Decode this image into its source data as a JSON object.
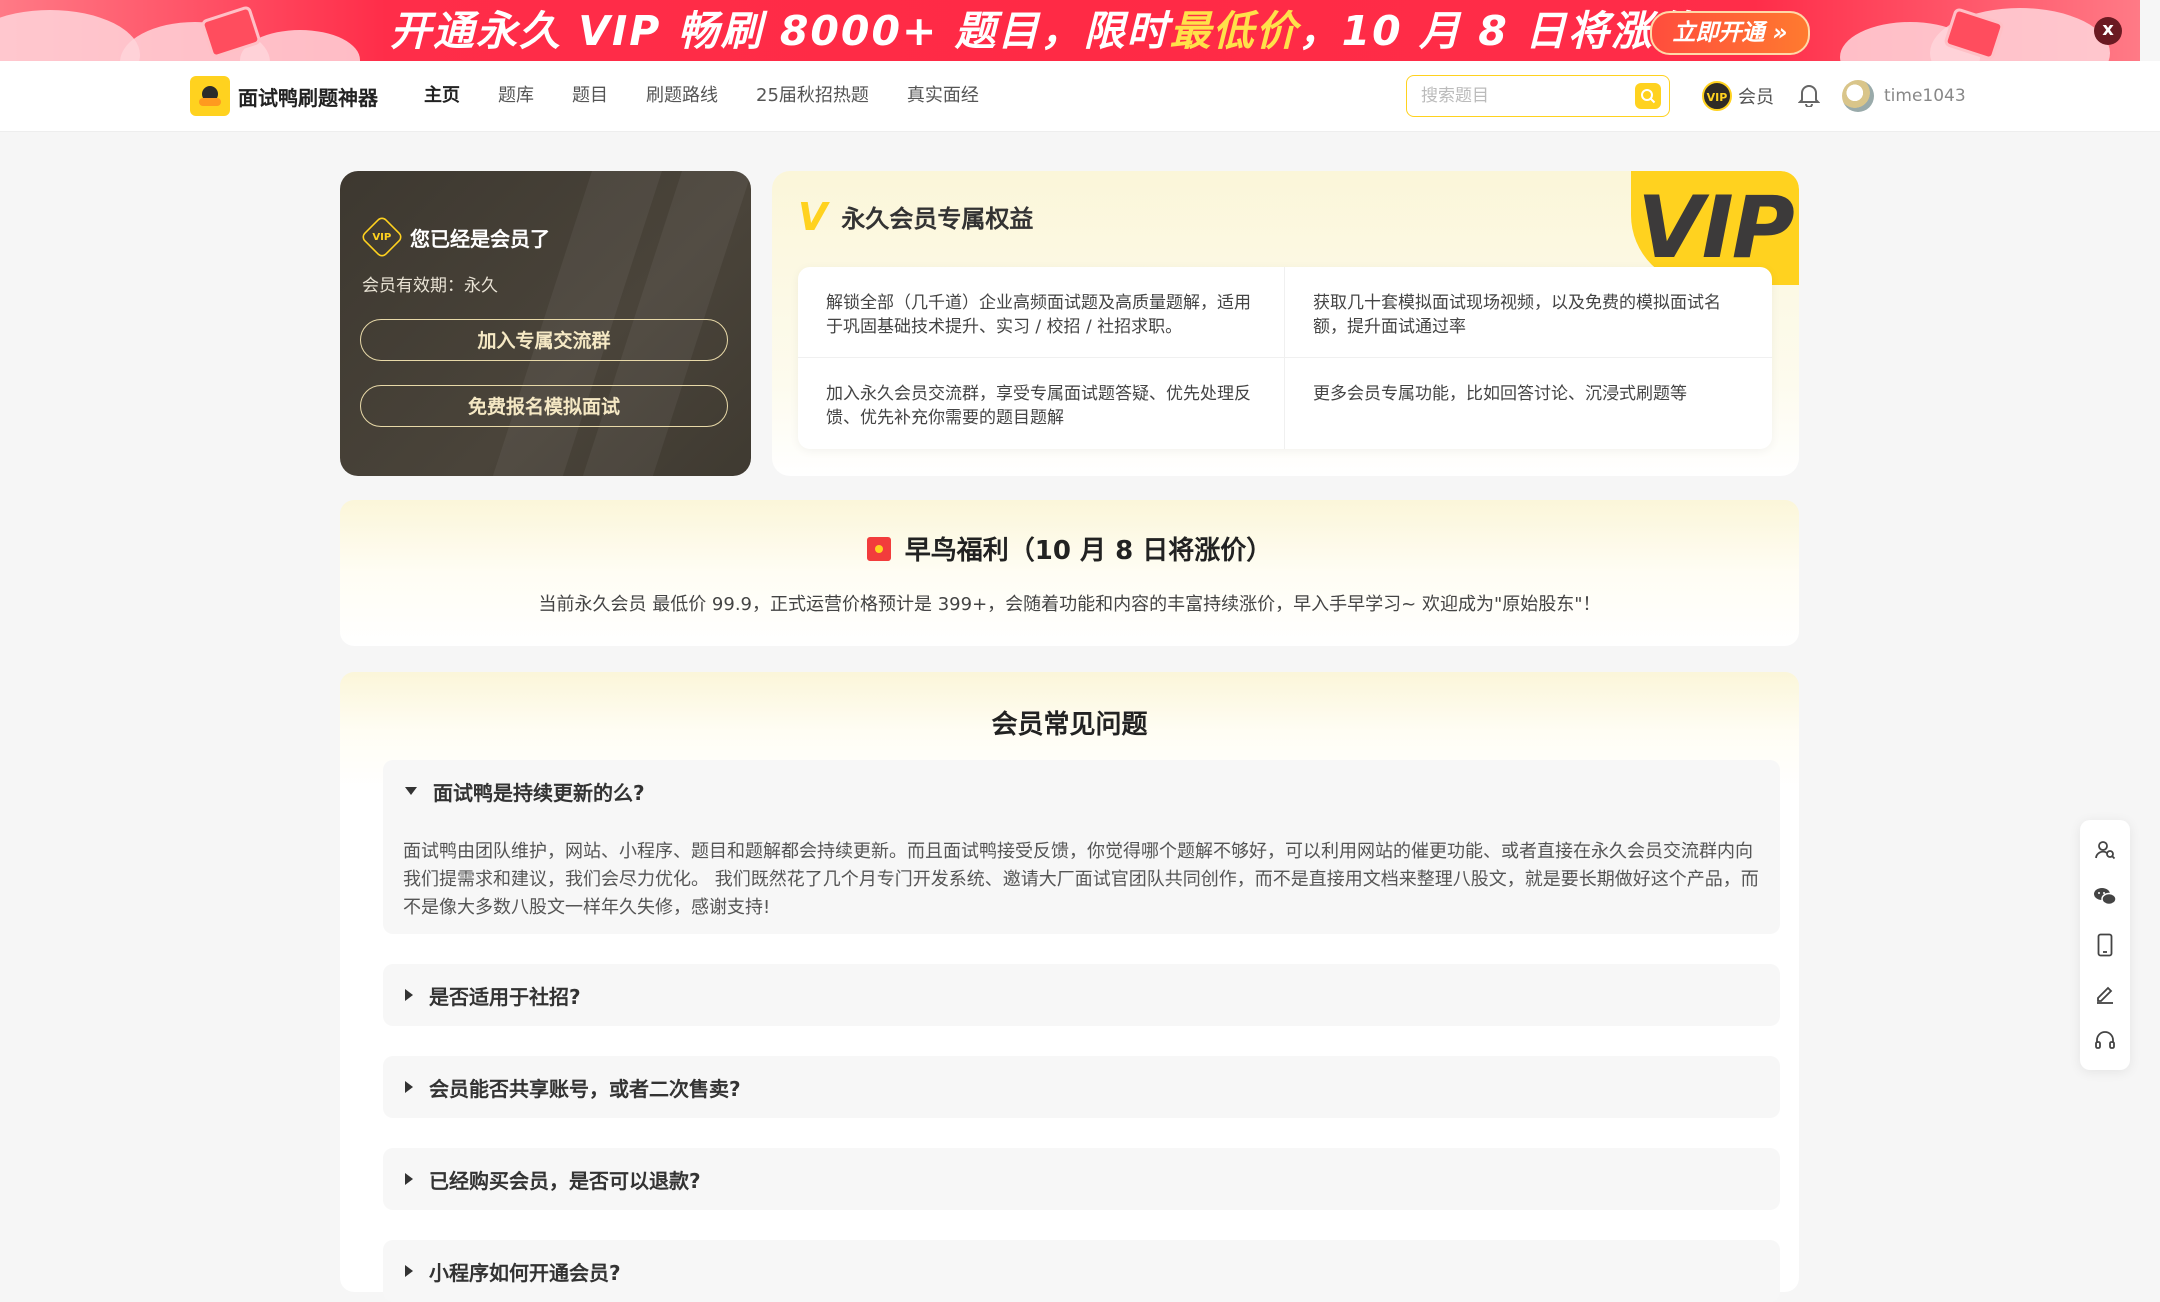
{
  "banner": {
    "text_pre": "开通永久 VIP 畅刷 8000+ 题目，限时",
    "text_hl": "最低价",
    "text_post": "，10 月 8 日将涨价！",
    "cta": "立即开通 »",
    "close": "x",
    "colors": {
      "bg": "#ff2a45",
      "highlight": "#ffe14a"
    }
  },
  "nav": {
    "logo_text": "面试鸭刷题神器",
    "items": [
      "主页",
      "题库",
      "题目",
      "刷题路线",
      "25届秋招热题",
      "真实面经"
    ],
    "active": "主页",
    "search_placeholder": "搜索题目",
    "vip_label": "会员",
    "vip_badge": "VIP",
    "username": "time1043"
  },
  "member_card": {
    "badge": "VIP",
    "title": "您已经是会员了",
    "expiry": "会员有效期：永久",
    "buttons": [
      "加入专属交流群",
      "免费报名模拟面试"
    ]
  },
  "benefits": {
    "mark": "V",
    "title": "永久会员专属权益",
    "vip_watermark": "VIP",
    "items": [
      "解锁全部（几千道）企业高频面试题及高质量题解，适用于巩固基础技术提升、实习 / 校招 / 社招求职。",
      "获取几十套模拟面试现场视频，以及免费的模拟面试名额，提升面试通过率",
      "加入永久会员交流群，享受专属面试题答疑、优先处理反馈、优先补充你需要的题目题解",
      "更多会员专属功能，比如回答讨论、沉浸式刷题等"
    ]
  },
  "early_bird": {
    "title": "早鸟福利（10 月 8 日将涨价）",
    "desc": "当前永久会员 最低价 99.9，正式运营价格预计是 399+，会随着功能和内容的丰富持续涨价，早入手早学习~ 欢迎成为\"原始股东\"！"
  },
  "faq": {
    "title": "会员常见问题",
    "items": [
      {
        "q": "面试鸭是持续更新的么?",
        "a": "面试鸭由团队维护，网站、小程序、题目和题解都会持续更新。而且面试鸭接受反馈，你觉得哪个题解不够好，可以利用网站的催更功能、或者直接在永久会员交流群内向我们提需求和建议，我们会尽力优化。 我们既然花了几个月专门开发系统、邀请大厂面试官团队共同创作，而不是直接用文档来整理八股文，就是要长期做好这个产品，而不是像大多数八股文一样年久失修，感谢支持!",
        "expanded": true
      },
      {
        "q": "是否适用于社招?",
        "expanded": false
      },
      {
        "q": "会员能否共享账号，或者二次售卖?",
        "expanded": false
      },
      {
        "q": "已经购买会员，是否可以退款?",
        "expanded": false
      },
      {
        "q": "小程序如何开通会员?",
        "expanded": false
      }
    ]
  },
  "side_toolbar": {
    "icons": [
      "user-search-icon",
      "wechat-icon",
      "mobile-icon",
      "edit-icon",
      "headset-icon"
    ]
  }
}
